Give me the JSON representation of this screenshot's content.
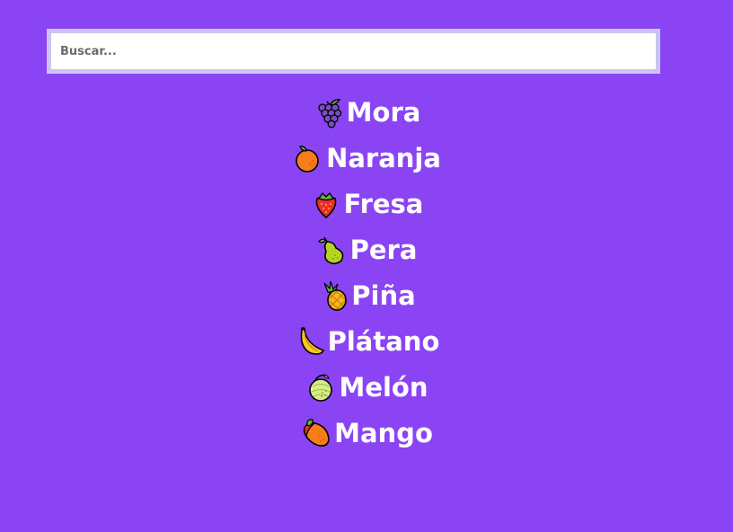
{
  "search": {
    "placeholder": "Buscar..."
  },
  "fruits": [
    {
      "icon": "grapes-icon",
      "name": "Mora"
    },
    {
      "icon": "tangerine-icon",
      "name": "Naranja"
    },
    {
      "icon": "strawberry-icon",
      "name": "Fresa"
    },
    {
      "icon": "pear-icon",
      "name": "Pera"
    },
    {
      "icon": "pineapple-icon",
      "name": "Piña"
    },
    {
      "icon": "banana-icon",
      "name": "Plátano"
    },
    {
      "icon": "melon-icon",
      "name": "Melón"
    },
    {
      "icon": "mango-icon",
      "name": "Mango"
    }
  ],
  "colors": {
    "background": "#8b44f4",
    "search_border": "#c9c5f2",
    "text": "#ffffff"
  }
}
